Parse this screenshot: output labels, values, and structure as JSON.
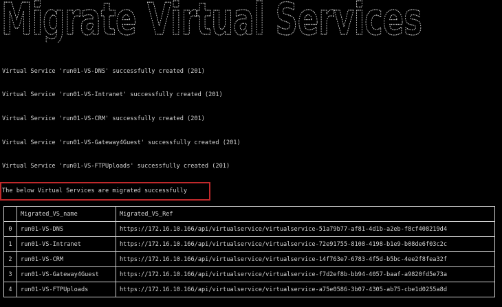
{
  "banner": {
    "title": "Migrate Virtual Services"
  },
  "log": [
    "Virtual Service 'run01-VS-DNS' successfully created (201)",
    "Virtual Service 'run01-VS-Intranet' successfully created (201)",
    "Virtual Service 'run01-VS-CRM' successfully created (201)",
    "Virtual Service 'run01-VS-Gateway4Guest' successfully created (201)",
    "Virtual Service 'run01-VS-FTPUploads' successfully created (201)"
  ],
  "summary": "The below Virtual Services are migrated successfully",
  "table": {
    "headers": {
      "index": "",
      "name": "Migrated_VS_name",
      "ref": "Migrated_VS_Ref"
    },
    "rows": [
      {
        "index": "0",
        "name": "run01-VS-DNS",
        "ref": "https://172.16.10.166/api/virtualservice/virtualservice-51a79b77-af81-4d1b-a2eb-f8cf408219d4"
      },
      {
        "index": "1",
        "name": "run01-VS-Intranet",
        "ref": "https://172.16.10.166/api/virtualservice/virtualservice-72e91755-8108-4198-b1e9-b08de6f03c2c"
      },
      {
        "index": "2",
        "name": "run01-VS-CRM",
        "ref": "https://172.16.10.166/api/virtualservice/virtualservice-14f763e7-6783-4f5d-b5bc-4ee2f8fea32f"
      },
      {
        "index": "3",
        "name": "run01-VS-Gateway4Guest",
        "ref": "https://172.16.10.166/api/virtualservice/virtualservice-f7d2ef8b-bb94-4057-baaf-a9820fd5e73a"
      },
      {
        "index": "4",
        "name": "run01-VS-FTPUploads",
        "ref": "https://172.16.10.166/api/virtualservice/virtualservice-a75e0586-3b07-4305-ab75-cbe1d0255a8d"
      }
    ]
  },
  "colors": {
    "background": "#000000",
    "text": "#d4d4d4",
    "highlight_border": "#c0292b"
  }
}
